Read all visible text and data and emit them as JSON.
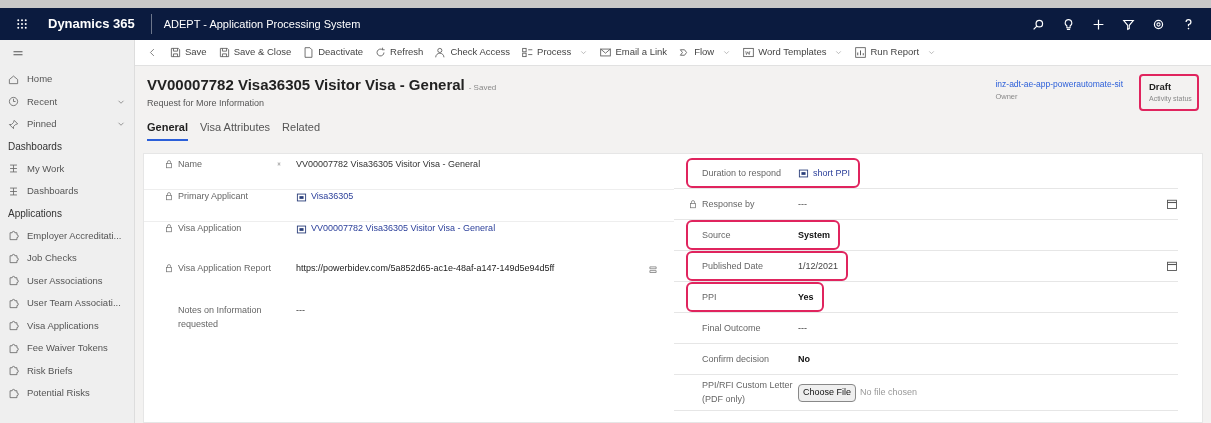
{
  "app_bar": {
    "app_name": "Dynamics 365",
    "area_title": "ADEPT - Application Processing System"
  },
  "sidebar": {
    "items": [
      {
        "kind": "nav",
        "label": "Home",
        "expandable": false
      },
      {
        "kind": "nav",
        "label": "Recent",
        "expandable": true
      },
      {
        "kind": "nav",
        "label": "Pinned",
        "expandable": true
      },
      {
        "kind": "section",
        "label": "Dashboards"
      },
      {
        "kind": "nav",
        "label": "My Work",
        "expandable": false
      },
      {
        "kind": "nav",
        "label": "Dashboards",
        "expandable": false
      },
      {
        "kind": "section",
        "label": "Applications"
      },
      {
        "kind": "nav",
        "label": "Employer Accreditati...",
        "expandable": false
      },
      {
        "kind": "nav",
        "label": "Job Checks",
        "expandable": false
      },
      {
        "kind": "nav",
        "label": "User Associations",
        "expandable": false
      },
      {
        "kind": "nav",
        "label": "User Team Associati...",
        "expandable": false
      },
      {
        "kind": "nav",
        "label": "Visa Applications",
        "expandable": false
      },
      {
        "kind": "nav",
        "label": "Fee Waiver Tokens",
        "expandable": false
      },
      {
        "kind": "nav",
        "label": "Risk Briefs",
        "expandable": false
      },
      {
        "kind": "nav",
        "label": "Potential Risks",
        "expandable": false
      }
    ]
  },
  "command_bar": [
    {
      "label": "Save",
      "dropdown": false
    },
    {
      "label": "Save & Close",
      "dropdown": false
    },
    {
      "label": "Deactivate",
      "dropdown": false
    },
    {
      "label": "Refresh",
      "dropdown": false
    },
    {
      "label": "Check Access",
      "dropdown": false
    },
    {
      "label": "Process",
      "dropdown": true
    },
    {
      "label": "Email a Link",
      "dropdown": false
    },
    {
      "label": "Flow",
      "dropdown": true
    },
    {
      "label": "Word Templates",
      "dropdown": true
    },
    {
      "label": "Run Report",
      "dropdown": true
    }
  ],
  "header": {
    "title": "VV00007782 Visa36305 Visitor Visa - General",
    "save_state": "- Saved",
    "entity": "Request for More Information",
    "owner": {
      "value": "inz-adt-ae-app-powerautomate-sit",
      "label": "Owner"
    },
    "status": {
      "value": "Draft",
      "label": "Activity status",
      "highlighted": true
    }
  },
  "tabs": [
    {
      "label": "General",
      "selected": true
    },
    {
      "label": "Visa Attributes",
      "selected": false
    },
    {
      "label": "Related",
      "selected": false
    }
  ],
  "left_fields": [
    {
      "label": "Name",
      "kind": "text",
      "value": "VV00007782 Visa36305 Visitor Visa - General",
      "locked": true,
      "required": true
    },
    {
      "label": "Primary Applicant",
      "kind": "lookup",
      "value": "Visa36305",
      "locked": true,
      "required": false
    },
    {
      "label": "Visa Application",
      "kind": "lookup",
      "value": "VV00007782 Visa36305 Visitor Visa - General",
      "locked": true,
      "required": false
    },
    {
      "label": "Visa Application Report",
      "kind": "url",
      "value": "https://powerbidev.com/5a852d65-ac1e-48af-a147-149d5e94d5ff",
      "locked": true,
      "required": false
    },
    {
      "label": "Notes on Information requested",
      "kind": "text",
      "value": "---",
      "locked": false,
      "required": false
    }
  ],
  "right_fields": [
    {
      "label": "Duration to respond",
      "kind": "lookup",
      "value": "short PPI",
      "locked": false,
      "highlighted": true
    },
    {
      "label": "Response by",
      "kind": "date",
      "value": "---",
      "locked": true,
      "highlighted": false
    },
    {
      "label": "Source",
      "kind": "bold",
      "value": "System",
      "locked": false,
      "highlighted": true
    },
    {
      "label": "Published Date",
      "kind": "date",
      "value": "1/12/2021",
      "locked": false,
      "highlighted": true
    },
    {
      "label": "PPI",
      "kind": "bold",
      "value": "Yes",
      "locked": false,
      "highlighted": true
    },
    {
      "label": "Final Outcome",
      "kind": "text",
      "value": "---",
      "locked": false,
      "highlighted": false
    },
    {
      "label": "Confirm decision",
      "kind": "bold",
      "value": "No",
      "locked": false,
      "highlighted": false
    },
    {
      "label": "PPI/RFI Custom Letter (PDF only)",
      "kind": "file",
      "placeholder": "No file chosen",
      "button": "Choose File",
      "locked": false,
      "highlighted": false
    }
  ]
}
